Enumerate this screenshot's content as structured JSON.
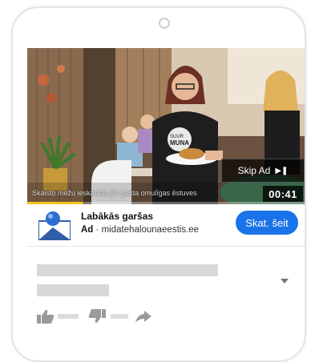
{
  "video": {
    "subtitle": "Skaisto mežu ieskautās jūs gaida omulīgas ēstuves",
    "shirt_text_line1": "SUUR",
    "shirt_text_line2": "MUNA",
    "progress_fraction": 0.2
  },
  "player": {
    "skip_label": "Skip Ad",
    "skip_icon": "skip-next-icon",
    "time_remaining": "00:41"
  },
  "ad": {
    "title": "Labākās garšas",
    "badge": "Ad",
    "separator": "·",
    "domain": "midatehalounaeestis.ee",
    "cta_label": "Skat. šeit"
  },
  "colors": {
    "cta_blue": "#1a73e8",
    "progress_yellow": "#f5c518",
    "placeholder_gray": "#d8d8d8"
  }
}
